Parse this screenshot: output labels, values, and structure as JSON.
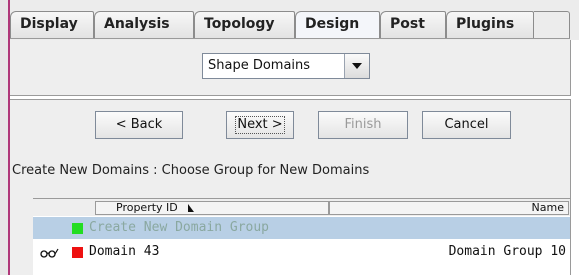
{
  "tabs": [
    {
      "label": "Display",
      "active": false
    },
    {
      "label": "Analysis",
      "active": false
    },
    {
      "label": "Topology",
      "active": false
    },
    {
      "label": "Design",
      "active": true
    },
    {
      "label": "Post",
      "active": false
    },
    {
      "label": "Plugins",
      "active": false
    }
  ],
  "dropdown": {
    "selected": "Shape Domains"
  },
  "wizard": {
    "back_label": "< Back",
    "next_label": "Next >",
    "finish_label": "Finish",
    "cancel_label": "Cancel",
    "instruction": "Create New Domains : Choose Group for New Domains"
  },
  "table": {
    "columns": [
      "Property ID",
      "Name"
    ],
    "rows": [
      {
        "id": "Create New Domain Group",
        "name": "",
        "color": "#22dd22",
        "text_color": "#8aa8a0",
        "icon": "none"
      },
      {
        "id": "Domain 43",
        "name": "Domain Group 10",
        "color": "#ee1111",
        "text_color": "#111111",
        "icon": "visibility-glasses-icon"
      }
    ]
  },
  "colors": {
    "selection": "#b8cfe5",
    "panel": "#eeeeee",
    "left_accent": "#b0397a"
  }
}
